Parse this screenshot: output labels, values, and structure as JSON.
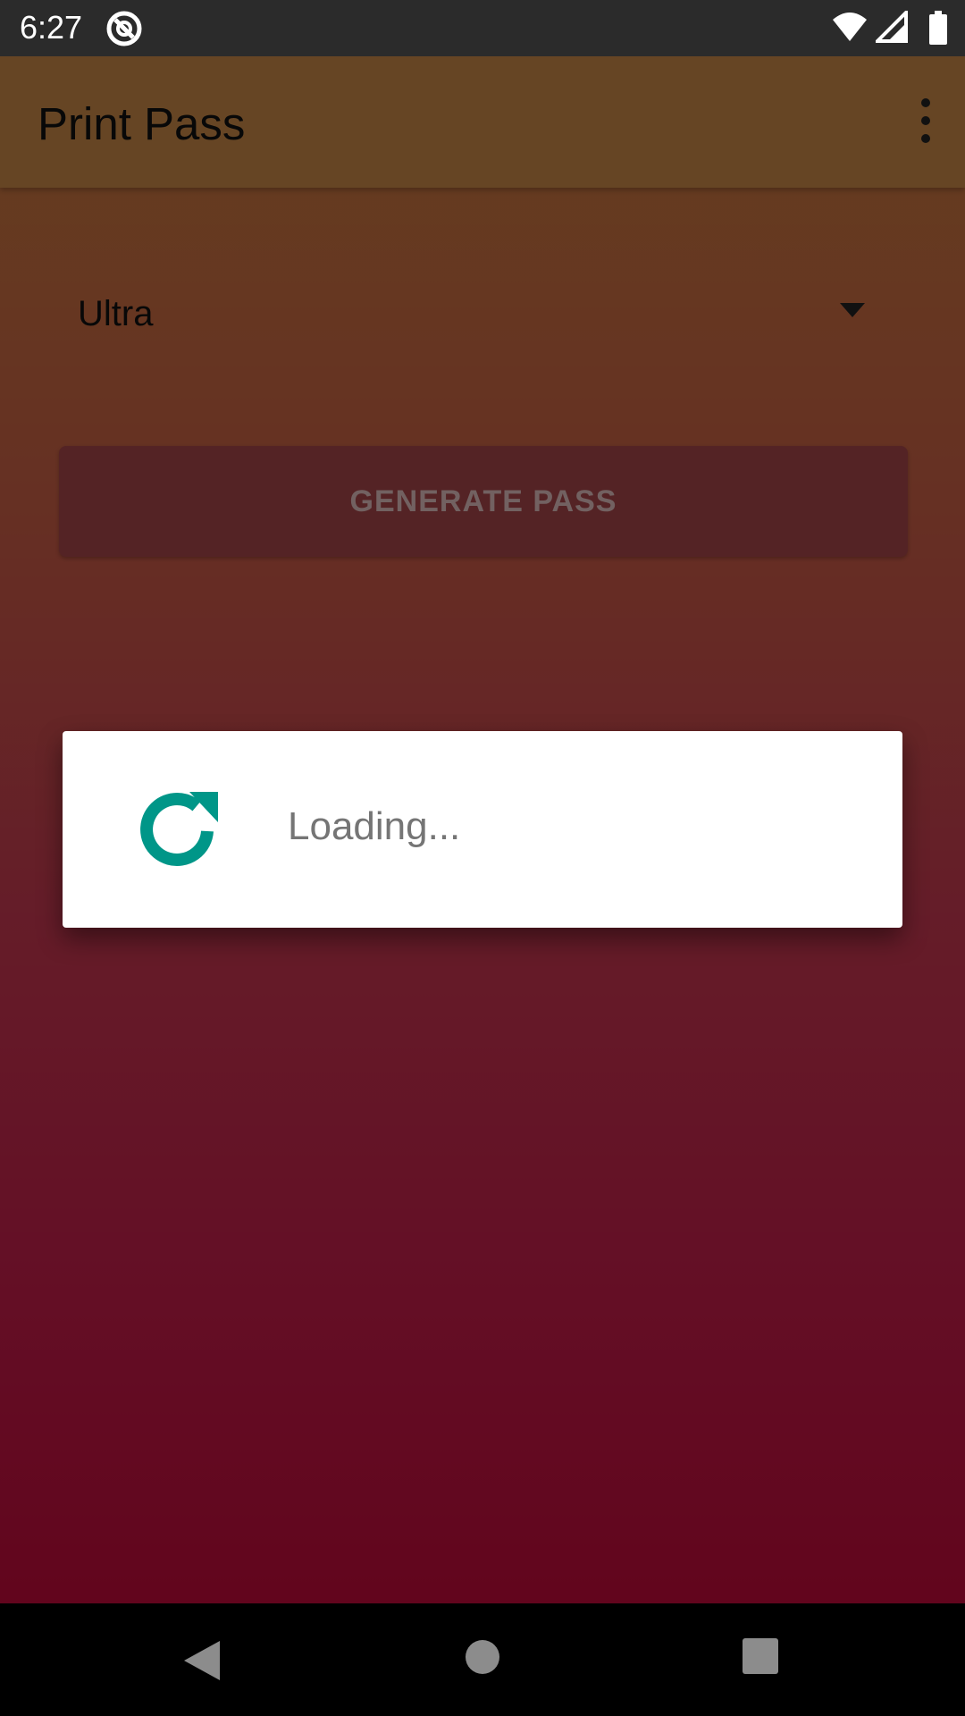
{
  "status_bar": {
    "time": "6:27",
    "icons": [
      "app-notification-icon",
      "wifi-icon",
      "signal-icon",
      "battery-icon"
    ]
  },
  "toolbar": {
    "title": "Print Pass",
    "overflow_icon": "more-vert-icon"
  },
  "form": {
    "spinner_value": "Ultra",
    "generate_button_label": "GENERATE PASS"
  },
  "dialog": {
    "message": "Loading...",
    "icon": "refresh-icon",
    "icon_color": "#009688"
  },
  "nav_bar": {
    "buttons": [
      "back-icon",
      "home-icon",
      "recents-icon"
    ]
  }
}
